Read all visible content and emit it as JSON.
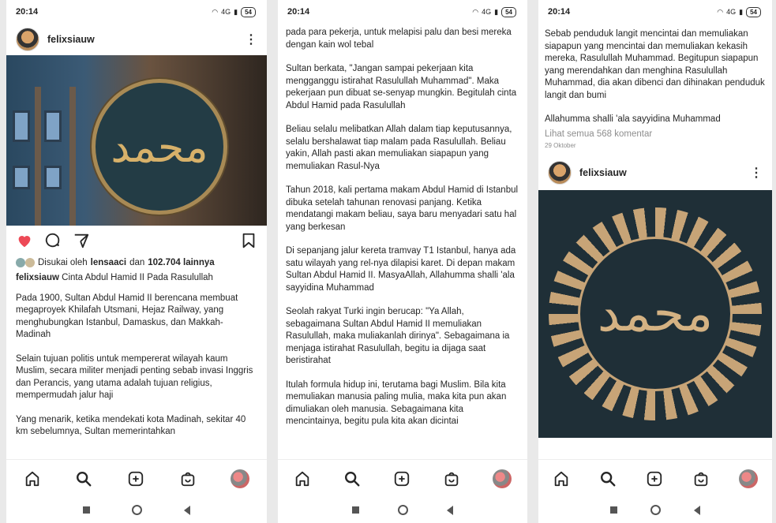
{
  "status": {
    "time": "20:14",
    "network": "4G",
    "battery": "54"
  },
  "post1": {
    "username": "felixsiauw",
    "likes_prefix": "Disukai oleh",
    "likes_user": "lensaaci",
    "likes_mid": "dan",
    "likes_count": "102.704 lainnya",
    "caption_user": "felixsiauw",
    "caption_text": "Cinta Abdul Hamid II Pada Rasulullah",
    "paragraphs": [
      "Pada 1900, Sultan Abdul Hamid II berencana membuat megaproyek Khilafah Utsmani, Hejaz Railway, yang menghubungkan Istanbul, Damaskus, dan Makkah-Madinah",
      "Selain tujuan politis untuk mempererat wilayah kaum Muslim, secara militer menjadi penting sebab invasi Inggris dan Perancis, yang utama adalah tujuan religius, mempermudah jalur haji",
      "Yang menarik, ketika mendekati kota Madinah, sekitar 40 km sebelumnya, Sultan memerintahkan"
    ],
    "calligraphy": "محمد"
  },
  "post2": {
    "paragraphs": [
      "pada para pekerja, untuk melapisi palu dan besi mereka dengan kain wol tebal",
      "Sultan berkata, \"Jangan sampai pekerjaan kita mengganggu istirahat Rasulullah Muhammad\". Maka pekerjaan pun dibuat se-senyap mungkin. Begitulah cinta Abdul Hamid pada Rasulullah",
      "Beliau selalu melibatkan Allah dalam tiap keputusannya, selalu bershalawat tiap malam pada Rasulullah. Beliau yakin, Allah pasti akan memuliakan siapapun yang memuliakan Rasul-Nya",
      "Tahun 2018, kali pertama makam Abdul Hamid di Istanbul dibuka setelah tahunan renovasi panjang. Ketika mendatangi makam beliau, saya baru menyadari satu hal yang berkesan",
      "Di sepanjang jalur kereta tramvay T1 Istanbul, hanya ada satu wilayah yang rel-nya dilapisi karet. Di depan makam Sultan Abdul Hamid II. MasyaAllah, Allahumma shalli 'ala sayyidina Muhammad",
      "Seolah rakyat Turki ingin berucap: \"Ya Allah, sebagaimana Sultan Abdul Hamid II memuliakan Rasulullah, maka muliakanlah dirinya\". Sebagaimana ia menjaga istirahat Rasulullah, begitu ia dijaga saat beristirahat",
      "Itulah formula hidup ini, terutama bagi Muslim. Bila kita memuliakan manusia paling mulia, maka kita pun akan dimuliakan oleh manusia. Sebagaimana kita mencintainya, begitu pula kita akan dicintai"
    ]
  },
  "post3": {
    "paragraphs": [
      "Sebab penduduk langit mencintai dan memuliakan siapapun yang mencintai dan memuliakan kekasih mereka, Rasulullah Muhammad. Begitupun siapapun yang merendahkan dan menghina Rasulullah Muhammad, dia akan dibenci dan dihinakan penduduk langit dan bumi",
      "Allahumma shalli 'ala sayyidina Muhammad"
    ],
    "view_comments": "Lihat semua 568 komentar",
    "date": "29 Oktober",
    "username": "felixsiauw",
    "calligraphy": "محمد"
  }
}
